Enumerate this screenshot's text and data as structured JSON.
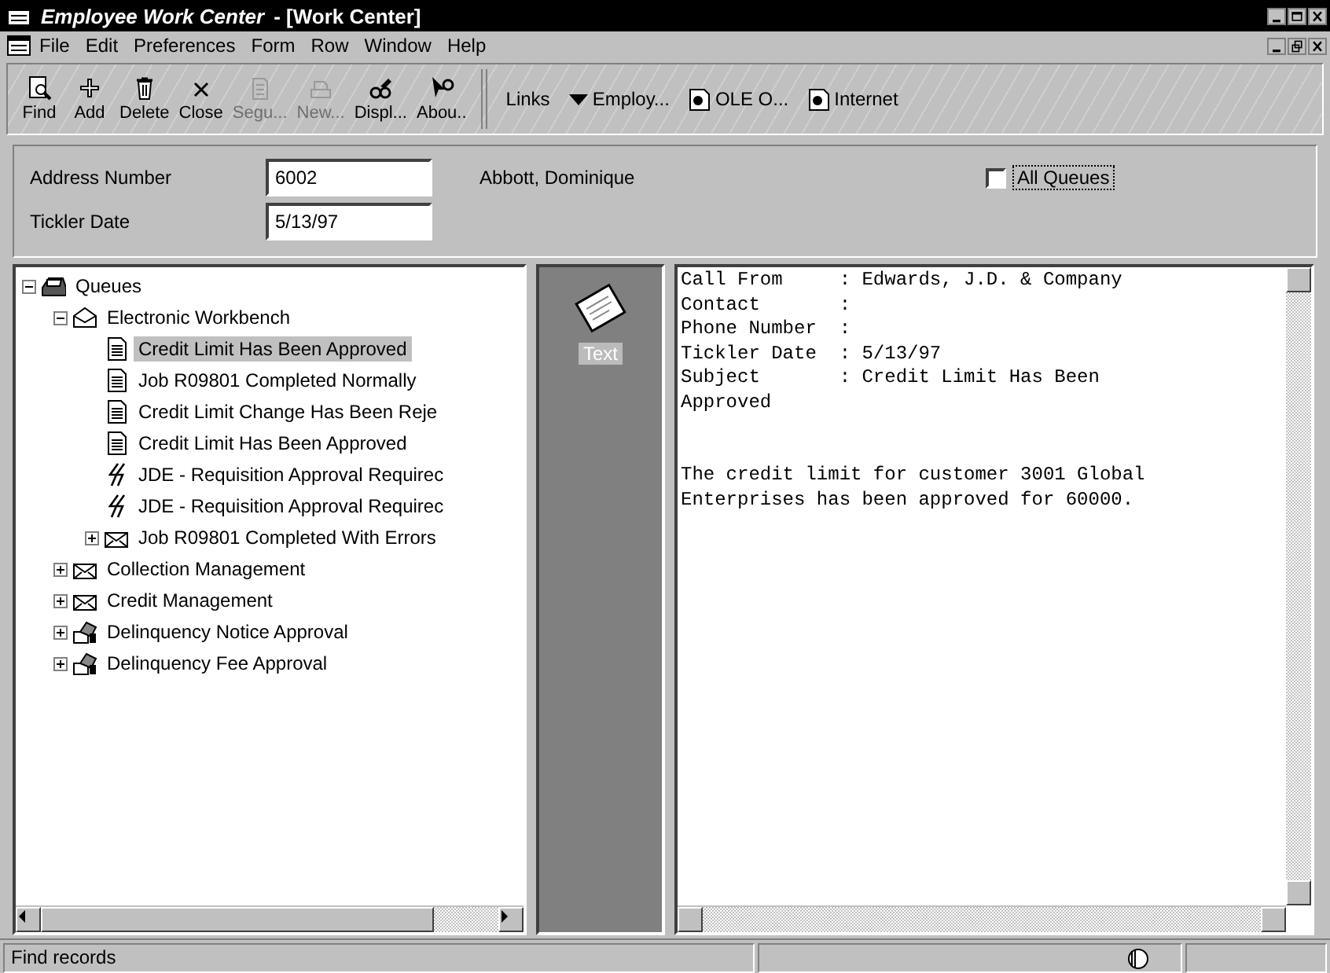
{
  "window": {
    "app_name": "Employee Work Center",
    "document": "- [Work Center]"
  },
  "menu": [
    "File",
    "Edit",
    "Preferences",
    "Form",
    "Row",
    "Window",
    "Help"
  ],
  "toolbar": [
    {
      "kind": "find",
      "label": "Find",
      "disabled": false
    },
    {
      "kind": "add",
      "label": "Add",
      "disabled": false
    },
    {
      "kind": "delete",
      "label": "Delete",
      "disabled": false
    },
    {
      "kind": "close",
      "label": "Close",
      "disabled": false
    },
    {
      "kind": "doc",
      "label": "Segu...",
      "disabled": true
    },
    {
      "kind": "new",
      "label": "New...",
      "disabled": true
    },
    {
      "kind": "display",
      "label": "Displ...",
      "disabled": false
    },
    {
      "kind": "about",
      "label": "Abou..",
      "disabled": false
    }
  ],
  "links": [
    {
      "kind": "dropdown",
      "label": "Links"
    },
    {
      "kind": "caret",
      "label": "Employ..."
    },
    {
      "kind": "ole",
      "label": "OLE O..."
    },
    {
      "kind": "ole",
      "label": "Internet"
    }
  ],
  "form": {
    "address_label": "Address Number",
    "address_value": "6002",
    "name": "Abbott, Dominique",
    "date_label": "Tickler Date",
    "date_value": "5/13/97",
    "all_queues": {
      "label": "All Queues",
      "checked": false
    }
  },
  "tree": [
    {
      "label": "Queues",
      "kind": "tray",
      "expanded": true,
      "selected": false,
      "children": [
        {
          "label": "Electronic Workbench",
          "kind": "open-mail",
          "expanded": true,
          "selected": false,
          "children": [
            {
              "label": "Credit Limit Has Been Approved",
              "kind": "doc",
              "selected": true
            },
            {
              "label": "Job R09801 Completed Normally",
              "kind": "doc",
              "selected": false
            },
            {
              "label": "Credit Limit Change Has Been Reje",
              "kind": "doc",
              "selected": false
            },
            {
              "label": "Credit Limit Has Been Approved",
              "kind": "doc",
              "selected": false
            },
            {
              "label": "JDE - Requisition Approval Requirec",
              "kind": "flash",
              "selected": false
            },
            {
              "label": "JDE - Requisition Approval Requirec",
              "kind": "flash",
              "selected": false
            },
            {
              "label": "Job R09801 Completed With Errors",
              "kind": "mail",
              "expanded": false,
              "selected": false
            }
          ]
        },
        {
          "label": "Collection Management",
          "kind": "mail",
          "expanded": false,
          "selected": false
        },
        {
          "label": "Credit Management",
          "kind": "mail",
          "expanded": false,
          "selected": false
        },
        {
          "label": "Delinquency Notice Approval",
          "kind": "approval",
          "expanded": false,
          "selected": false
        },
        {
          "label": "Delinquency Fee Approval",
          "kind": "approval",
          "expanded": false,
          "selected": false
        }
      ]
    }
  ],
  "attachment": {
    "label": "Text",
    "selected": true
  },
  "message": {
    "header": [
      "Call From     : Edwards, J.D. & Company",
      "Contact       :",
      "Phone Number  :",
      "Tickler Date  : 5/13/97",
      "Subject       : Credit Limit Has Been",
      "Approved"
    ],
    "body": [
      "The credit limit for customer 3001 Global",
      "Enterprises has been approved for 60000."
    ]
  },
  "status": "Find records"
}
